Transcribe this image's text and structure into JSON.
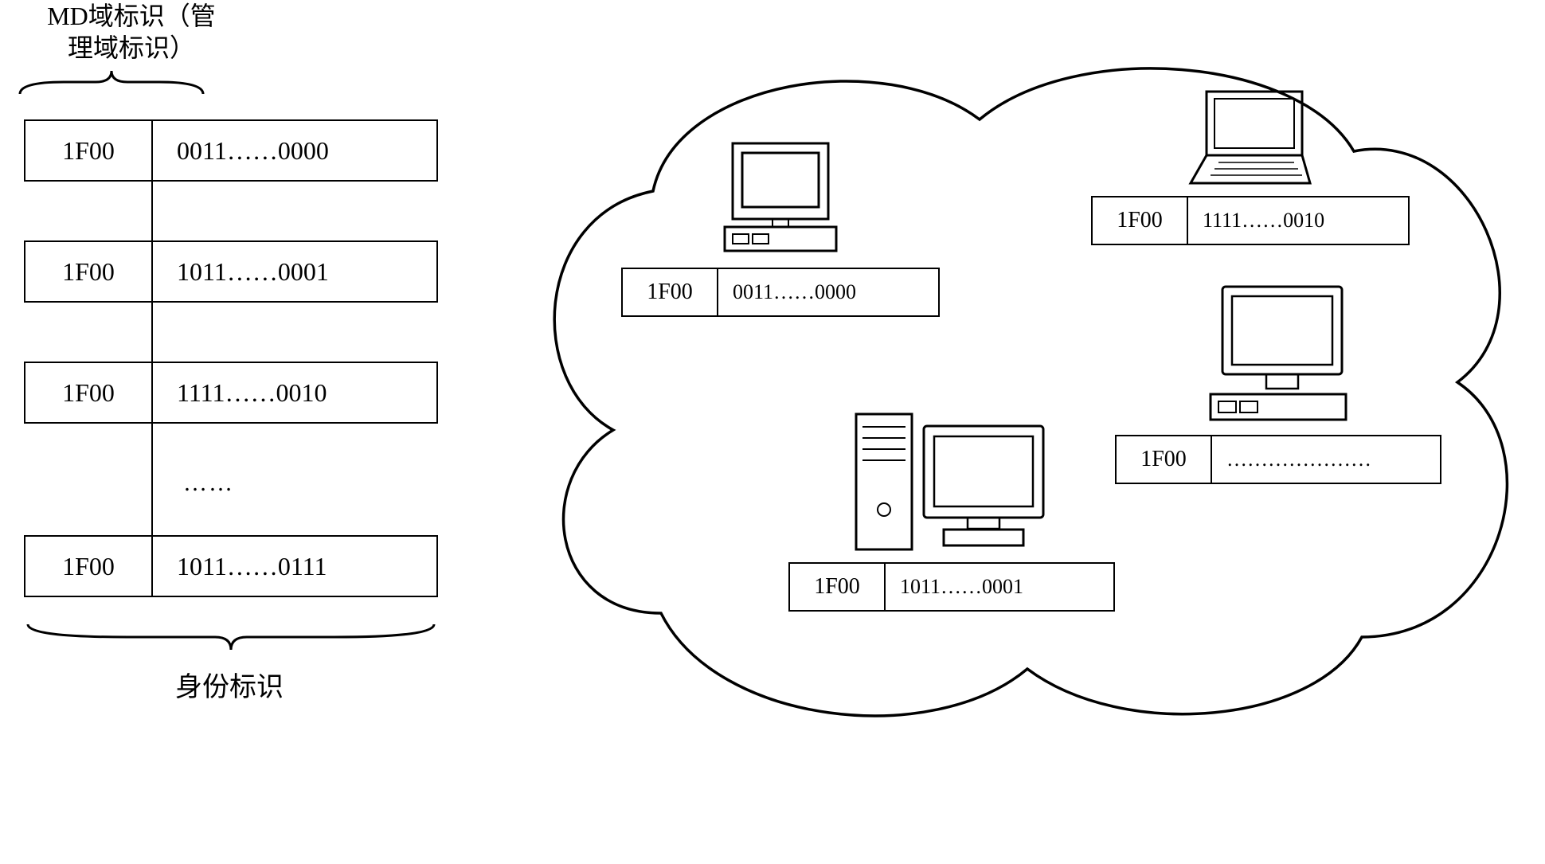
{
  "labels": {
    "topLine1": "MD域标识（管",
    "topLine2": "理域标识）",
    "bottom": "身份标识"
  },
  "md": "1F00",
  "leftRows": [
    "0011……0000",
    "1011……0001",
    "1111……0010",
    "1011……0111"
  ],
  "leftEllipsis": "……",
  "cloudNodes": {
    "a": {
      "md": "1F00",
      "val": "0011……0000"
    },
    "b": {
      "md": "1F00",
      "val": "1111……0010"
    },
    "c": {
      "md": "1F00",
      "val": "1011……0001"
    },
    "d": {
      "md": "1F00",
      "val": "…………………"
    }
  }
}
